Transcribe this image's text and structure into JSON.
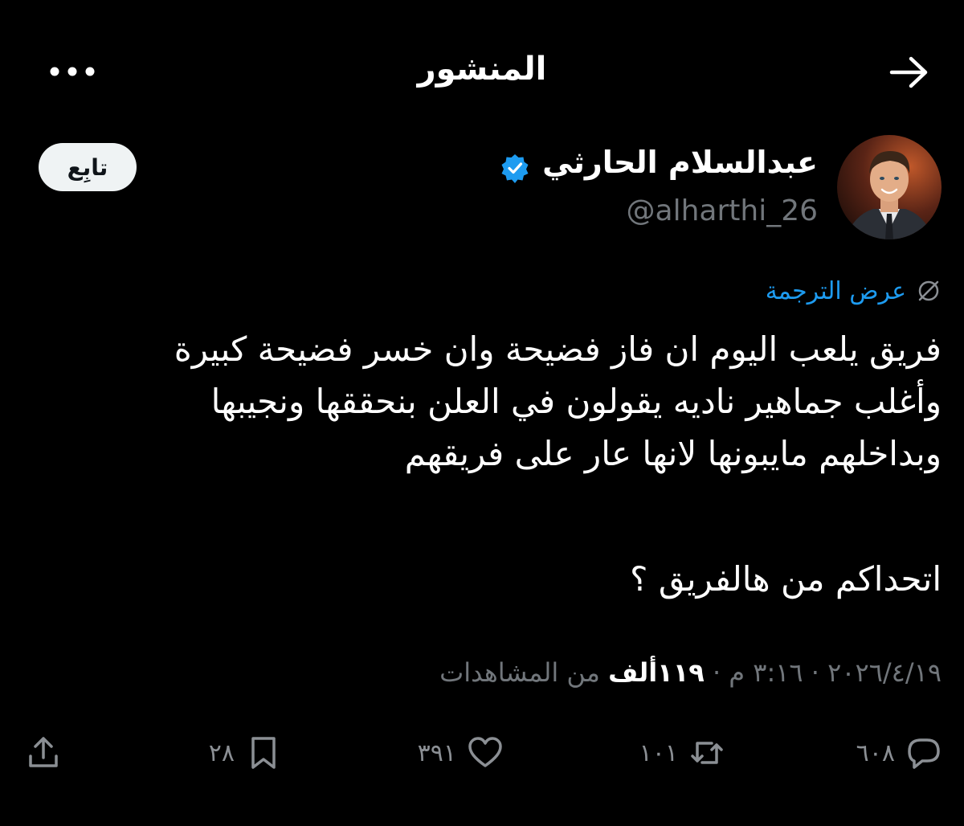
{
  "header": {
    "title": "المنشور",
    "back_icon": "arrow-right-icon",
    "more_icon": "more-dots-icon"
  },
  "author": {
    "name": "عبدالسلام الحارثي",
    "handle": "@alharthi_26",
    "verified_icon": "verified-badge-icon",
    "verified_color": "#1d9bf0"
  },
  "follow_button": {
    "label": "تابِع"
  },
  "translate": {
    "icon": "globe-slash-icon",
    "label": "عرض الترجمة",
    "color": "#1d9bf0"
  },
  "tweet": {
    "lines": [
      "فريق يلعب اليوم ان فاز فضيحة وان خسر فضيحة كبيرة",
      "وأغلب جماهير ناديه يقولون في العلن بنحققها ونجيبها",
      "وبداخلهم مايبونها لانها عار على فريقهم",
      "اتحداكم من هالفريق ؟"
    ]
  },
  "meta": {
    "date": "٢٠٢٦/٤/١٩",
    "separator": "·",
    "time": "٣:١٦ م",
    "views_count": "١١٩ألف",
    "views_label": "من المشاهدات"
  },
  "actions": {
    "replies": {
      "icon": "reply-icon",
      "count": "٦٠٨"
    },
    "reposts": {
      "icon": "repost-icon",
      "count": "١٠١"
    },
    "likes": {
      "icon": "heart-icon",
      "count": "٣٩١"
    },
    "bookmarks": {
      "icon": "bookmark-icon",
      "count": "٢٨"
    },
    "share": {
      "icon": "share-icon"
    }
  },
  "colors": {
    "background": "#000000",
    "text_primary": "#ffffff",
    "text_secondary": "#71767b",
    "accent": "#1d9bf0"
  }
}
